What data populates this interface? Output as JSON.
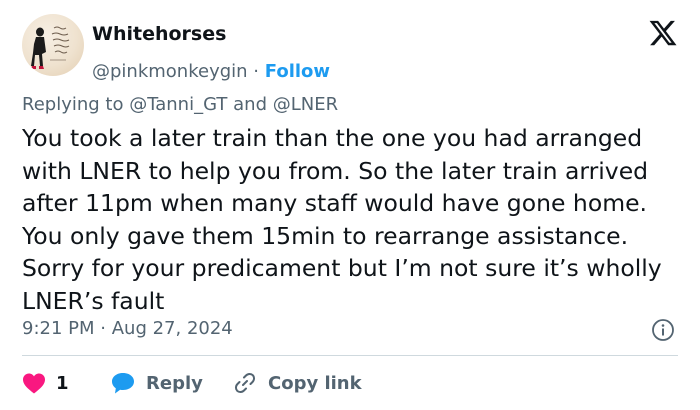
{
  "author": {
    "name": "Whitehorses",
    "handle": "@pinkmonkeygin",
    "separator": "·",
    "follow_label": "Follow"
  },
  "reply_context": {
    "prefix": "Replying to",
    "mention1": "@Tanni_GT",
    "conjunction": "and",
    "mention2": "@LNER"
  },
  "tweet": {
    "text": "You took a later train than the one you had arranged with LNER to help you from. So the later train arrived after 11pm when many staff would have gone home. You only gave them 15min to rearrange assistance. Sorry for your predicament but I’m not sure it’s wholly LNER’s fault",
    "time": "9:21 PM",
    "separator": "·",
    "date": "Aug 27, 2024"
  },
  "actions": {
    "like_count": "1",
    "reply_label": "Reply",
    "copy_link_label": "Copy link"
  },
  "icons": {
    "logo": "x-logo-icon",
    "info": "info-icon",
    "like": "heart-icon",
    "reply": "speech-bubble-icon",
    "copy": "link-icon"
  },
  "colors": {
    "accent": "#1d9bf0",
    "text": "#0f1419",
    "secondary": "#536471",
    "like": "#f91880"
  }
}
